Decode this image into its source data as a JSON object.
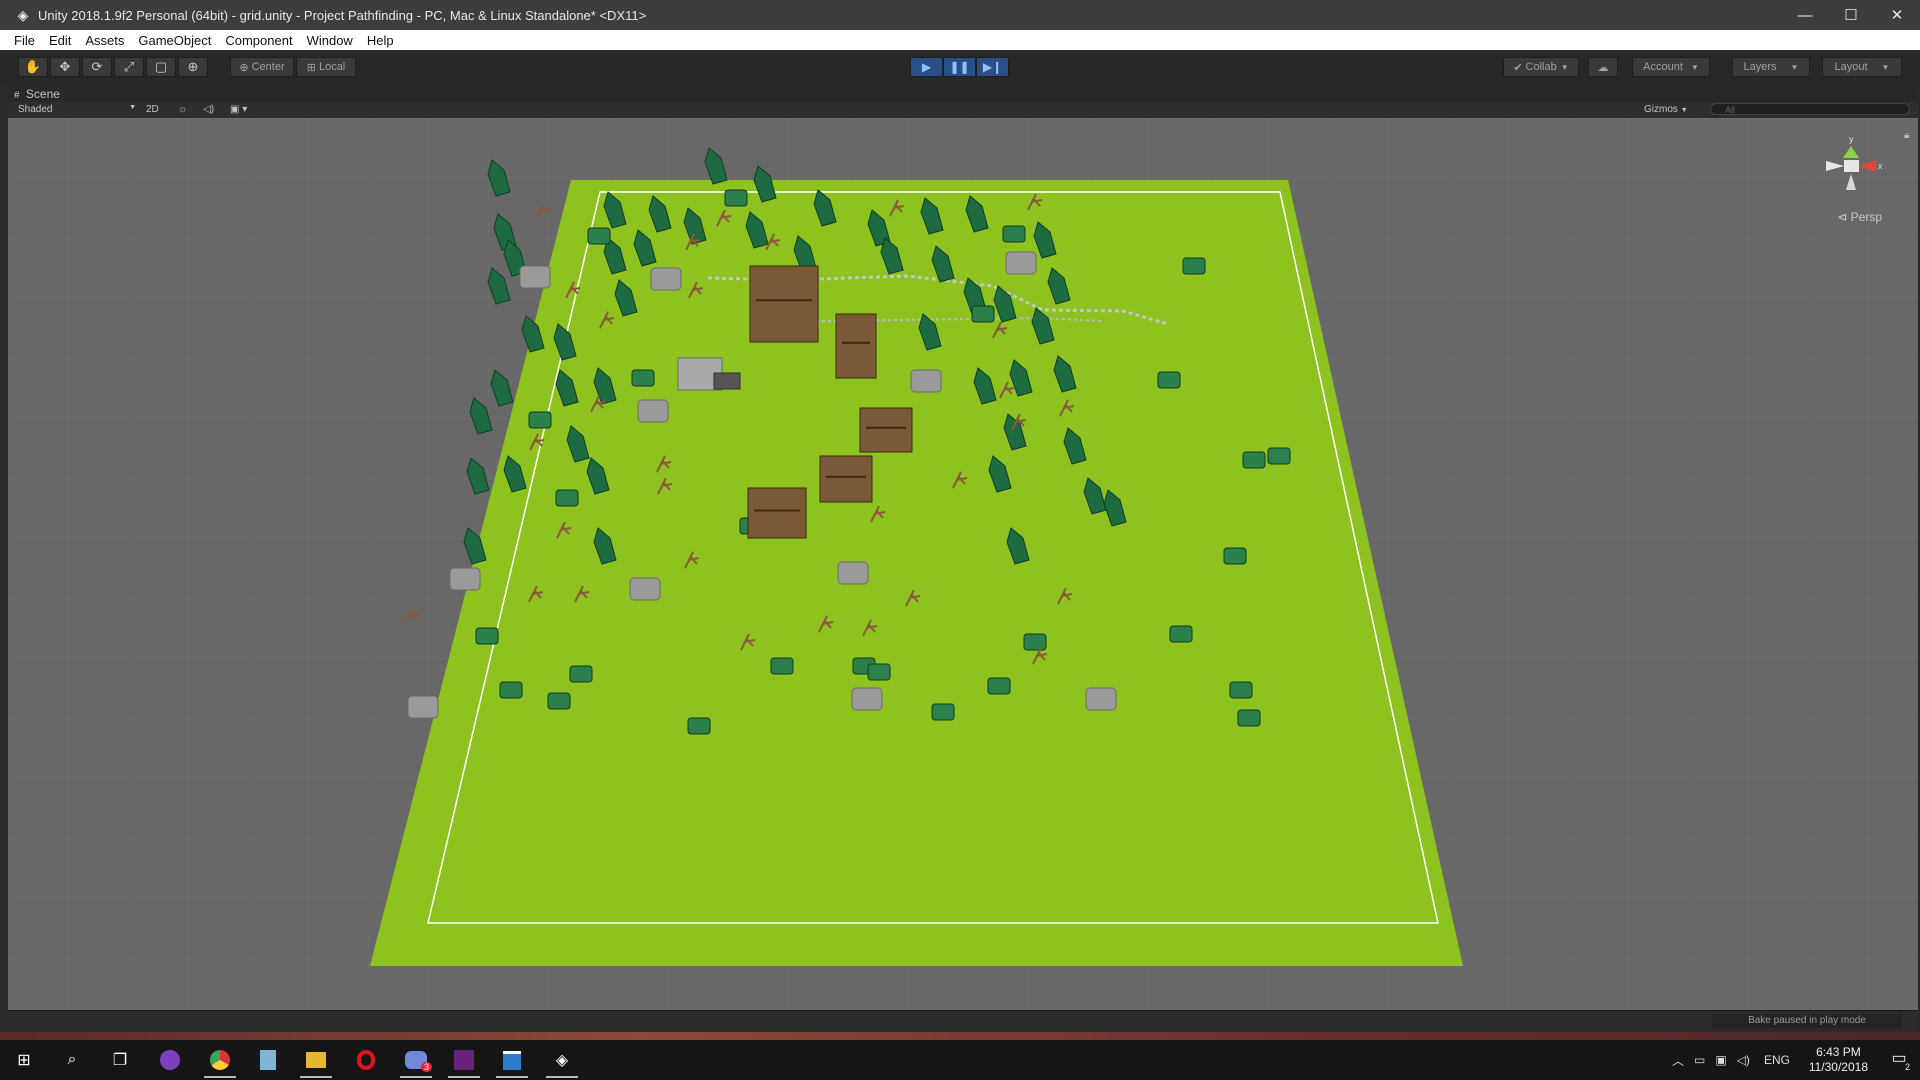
{
  "window": {
    "title": "Unity 2018.1.9f2 Personal (64bit) - grid.unity - Project Pathfinding - PC, Mac & Linux Standalone* <DX11>",
    "app_icon": "unity-icon",
    "controls": {
      "minimize": "—",
      "maximize": "☐",
      "close": "✕"
    }
  },
  "menu": [
    "File",
    "Edit",
    "Assets",
    "GameObject",
    "Component",
    "Window",
    "Help"
  ],
  "toolbar": {
    "tools": [
      "hand-tool-icon",
      "move-tool-icon",
      "rotate-tool-icon",
      "scale-tool-icon",
      "rect-tool-icon",
      "transform-tool-icon"
    ],
    "tool_glyphs": [
      "✋",
      "✥",
      "⟳",
      "⤢",
      "▢",
      "⊕"
    ],
    "pivot": "Center",
    "space": "Local",
    "play": "▶",
    "pause": "❚❚",
    "step": "▶❙",
    "collab": "Collab",
    "cloud": "☁",
    "account": "Account",
    "layers": "Layers",
    "layout": "Layout",
    "accent": "#2a4e86"
  },
  "scene": {
    "tab_label": "Scene",
    "shading_mode": "Shaded",
    "mode_2d": "2D",
    "gizmos": "Gizmos",
    "search_placeholder": "All",
    "projection": "Persp",
    "gizmo_axes": {
      "x": "x",
      "y": "y"
    },
    "colors": {
      "ground": "#8dc21f",
      "sky": "#686868",
      "tree": "#1e6b42",
      "house": "#7a5a36",
      "rock": "#9a9a9a"
    }
  },
  "status": {
    "bake": "Bake paused in play mode"
  },
  "taskbar": {
    "apps": [
      "windows-start-icon",
      "search-icon",
      "task-view-icon",
      "app-icon",
      "chrome-icon",
      "notepad-icon",
      "file-explorer-icon",
      "opera-icon",
      "discord-icon",
      "visual-studio-icon",
      "store-icon",
      "unity-icon"
    ],
    "discord_badge": "3",
    "language": "ENG",
    "time": "6:43 PM",
    "date": "11/30/2018",
    "notification_count": "2"
  }
}
